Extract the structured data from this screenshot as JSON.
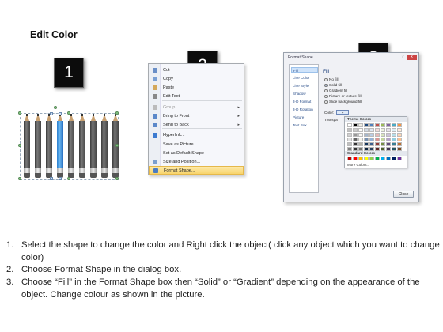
{
  "title": "Edit Color",
  "badges": [
    "1",
    "2",
    "3"
  ],
  "context_menu": {
    "items": [
      {
        "label": "Cut",
        "color": "#6a8fc7",
        "disabled": false,
        "submenu": false
      },
      {
        "label": "Copy",
        "color": "#7aa0d4",
        "disabled": false,
        "submenu": false
      },
      {
        "label": "Paste",
        "color": "#d4a85a",
        "disabled": false,
        "submenu": false
      },
      {
        "label": "Edit Text",
        "color": "#888888",
        "disabled": false,
        "submenu": false
      },
      {
        "label": "Group",
        "color": "#bbbbbb",
        "disabled": true,
        "submenu": true
      },
      {
        "label": "Bring to Front",
        "color": "#5b88c9",
        "disabled": false,
        "submenu": true
      },
      {
        "label": "Send to Back",
        "color": "#5b88c9",
        "disabled": false,
        "submenu": true
      },
      {
        "label": "Hyperlink...",
        "color": "#3c7bd0",
        "disabled": false,
        "submenu": false
      },
      {
        "label": "Save as Picture...",
        "color": "",
        "disabled": false,
        "submenu": false
      },
      {
        "label": "Set as Default Shape",
        "color": "",
        "disabled": false,
        "submenu": false
      },
      {
        "label": "Size and Position...",
        "color": "#7a9fcf",
        "disabled": false,
        "submenu": false
      },
      {
        "label": "Format Shape...",
        "color": "#4a7cc2",
        "disabled": false,
        "submenu": false,
        "highlighted": true
      }
    ]
  },
  "dialog": {
    "title": "Format Shape",
    "close_label": "x",
    "help_label": "?",
    "nav": [
      "Fill",
      "Line Color",
      "Line Style",
      "Shadow",
      "3-D Format",
      "3-D Rotation",
      "Picture",
      "Text Box"
    ],
    "fill_heading": "Fill",
    "options": [
      "No fill",
      "Solid fill",
      "Gradient fill",
      "Picture or texture fill",
      "Slide background fill"
    ],
    "color_label": "Color:",
    "transparency_label": "Transpa",
    "theme_colors_label": "Theme Colors",
    "standard_colors_label": "Standard Colors",
    "more_colors_label": "More Colors...",
    "close_button": "Close",
    "theme_top": [
      "#ffffff",
      "#000000",
      "#eeece1",
      "#1f497d",
      "#4f81bd",
      "#c0504d",
      "#9bbb59",
      "#8064a2",
      "#4bacc6",
      "#f79646"
    ],
    "standard": [
      "#c00000",
      "#ff0000",
      "#ffc000",
      "#ffff00",
      "#92d050",
      "#00b050",
      "#00b0f0",
      "#0070c0",
      "#002060",
      "#7030a0"
    ]
  },
  "instructions": [
    {
      "num": "1.",
      "text": "Select the shape to change the color and Right click the object( click any object which you want to change color)"
    },
    {
      "num": "2.",
      "text": "Choose Format Shape in the dialog box."
    },
    {
      "num": "3.",
      "text": "Choose “Fill” in the Format Shape box then “Solid” or “Gradient” depending on the appearance of the object. Change colour as shown in the picture."
    }
  ]
}
